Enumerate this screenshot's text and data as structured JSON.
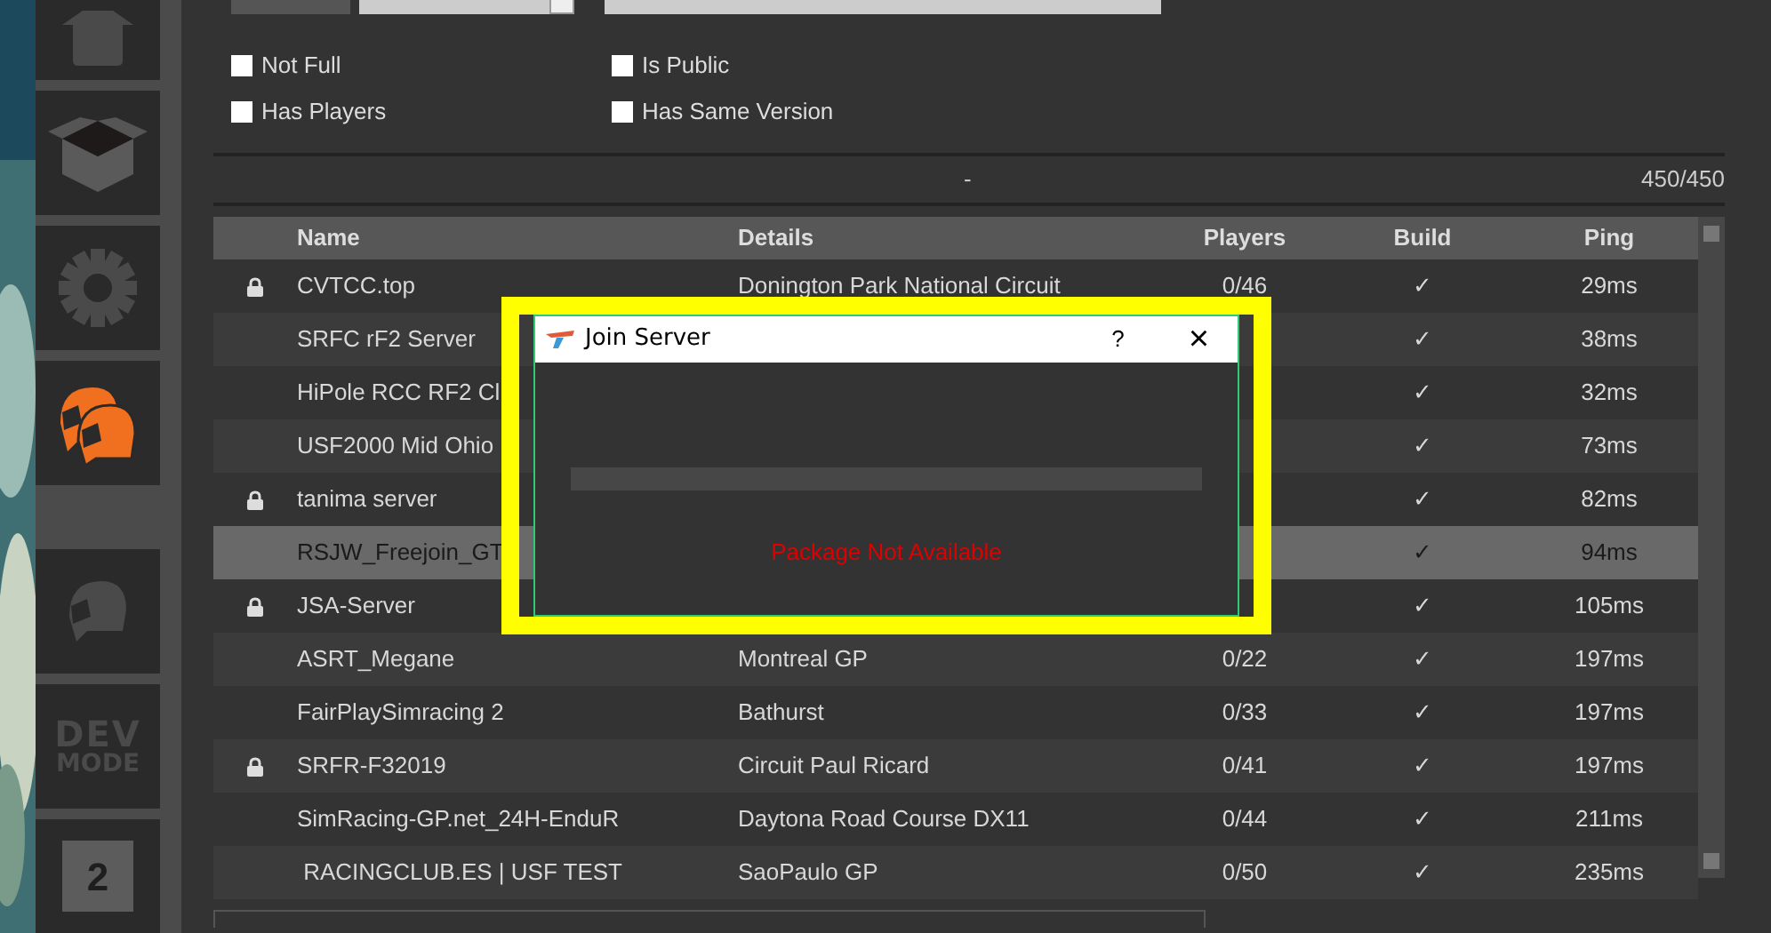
{
  "sidebar": {
    "items": [
      {
        "kind": "house",
        "selected": false
      },
      {
        "kind": "box",
        "selected": false
      },
      {
        "kind": "gear",
        "selected": false
      },
      {
        "kind": "helmets",
        "selected": true
      },
      {
        "kind": "helmet",
        "selected": false
      },
      {
        "kind": "dev",
        "label": "DEV",
        "sublabel": "MODE",
        "selected": false
      },
      {
        "kind": "logo",
        "label": "2",
        "selected": false
      }
    ]
  },
  "filters": [
    {
      "label": "Not Full",
      "checked": false
    },
    {
      "label": "Is Public",
      "checked": false
    },
    {
      "label": "Has Players",
      "checked": false
    },
    {
      "label": "Has Same Version",
      "checked": false
    }
  ],
  "status": {
    "center": "-",
    "count": "450/450"
  },
  "table": {
    "columns": [
      "Name",
      "Details",
      "Players",
      "Build",
      "Ping"
    ],
    "rows": [
      {
        "locked": true,
        "name": "CVTCC.top",
        "details": "Donington Park National Circuit",
        "players": "0/46",
        "build": "✓",
        "ping": "29ms",
        "selected": false
      },
      {
        "locked": false,
        "name": "SRFC rF2 Server",
        "build": "✓",
        "ping": "38ms",
        "selected": false
      },
      {
        "locked": false,
        "name": "HiPole RCC RF2 Cl",
        "build": "✓",
        "ping": "32ms",
        "selected": false
      },
      {
        "locked": false,
        "name": "USF2000 Mid Ohio",
        "build": "✓",
        "ping": "73ms",
        "selected": false
      },
      {
        "locked": true,
        "name": "tanima server",
        "build": "✓",
        "ping": "82ms",
        "selected": false
      },
      {
        "locked": false,
        "name": "RSJW_Freejoin_GT",
        "build": "✓",
        "ping": "94ms",
        "selected": true
      },
      {
        "locked": true,
        "name": "JSA-Server",
        "build": "✓",
        "ping": "105ms",
        "selected": false
      },
      {
        "locked": false,
        "name": "ASRT_Megane",
        "details": "Montreal GP",
        "players": "0/22",
        "build": "✓",
        "ping": "197ms",
        "selected": false
      },
      {
        "locked": false,
        "name": "FairPlaySimracing 2",
        "details": "Bathurst",
        "players": "0/33",
        "build": "✓",
        "ping": "197ms",
        "selected": false
      },
      {
        "locked": true,
        "name": "SRFR-F32019",
        "details": "Circuit Paul Ricard",
        "players": "0/41",
        "build": "✓",
        "ping": "197ms",
        "selected": false
      },
      {
        "locked": false,
        "name": "SimRacing-GP.net_24H-EnduR",
        "details": "Daytona Road Course DX11",
        "players": "0/44",
        "build": "✓",
        "ping": "211ms",
        "selected": false
      },
      {
        "locked": false,
        "name": " RACINGCLUB.ES | USF TEST",
        "details": "SaoPaulo GP",
        "players": "0/50",
        "build": "✓",
        "ping": "235ms",
        "selected": false
      }
    ]
  },
  "dialog": {
    "title": "Join Server",
    "help": "?",
    "close": "×",
    "level": 0,
    "message": "Package Not Available"
  }
}
